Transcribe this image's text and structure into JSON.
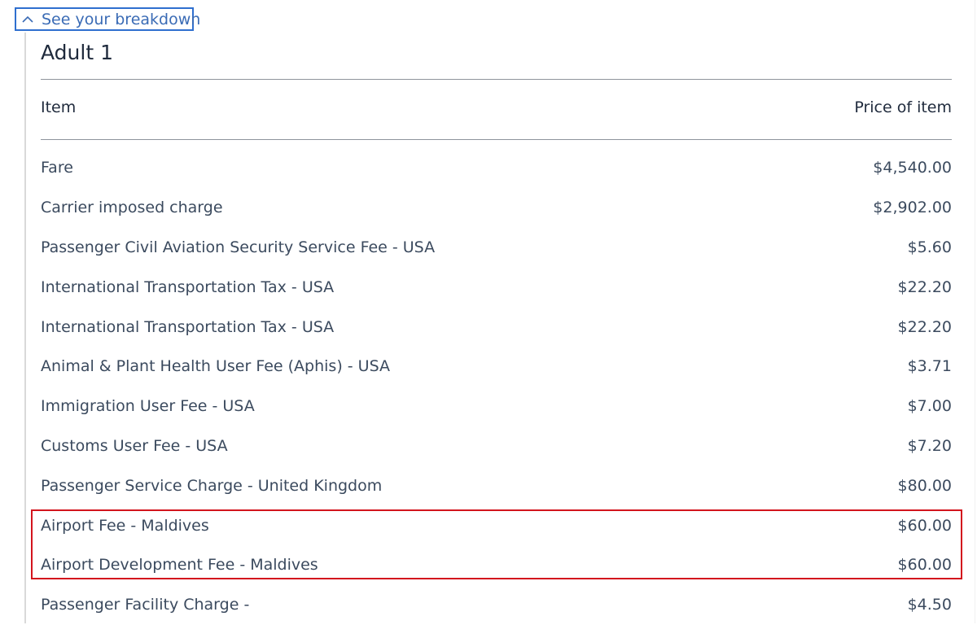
{
  "breakdown_toggle": {
    "label": "See your breakdown",
    "icon": "chevron-up-icon",
    "expanded": true,
    "border_color": "#2f6fcf"
  },
  "passenger": {
    "title": "Adult 1"
  },
  "table": {
    "headers": {
      "item": "Item",
      "price": "Price of item"
    },
    "rows": [
      {
        "label": "Fare",
        "price": "$4,540.00"
      },
      {
        "label": "Carrier imposed charge",
        "price": "$2,902.00"
      },
      {
        "label": "Passenger Civil Aviation Security Service Fee - USA",
        "price": "$5.60"
      },
      {
        "label": "International Transportation Tax - USA",
        "price": "$22.20"
      },
      {
        "label": "International Transportation Tax - USA",
        "price": "$22.20"
      },
      {
        "label": "Animal & Plant Health User Fee (Aphis) - USA",
        "price": "$3.71"
      },
      {
        "label": "Immigration User Fee - USA",
        "price": "$7.00"
      },
      {
        "label": "Customs User Fee - USA",
        "price": "$7.20"
      },
      {
        "label": "Passenger Service Charge - United Kingdom",
        "price": "$80.00"
      },
      {
        "label": "Airport Fee - Maldives",
        "price": "$60.00"
      },
      {
        "label": "Airport Development Fee - Maldives",
        "price": "$60.00"
      },
      {
        "label": "Passenger Facility Charge -",
        "price": "$4.50"
      }
    ]
  },
  "annotation": {
    "highlighted_rows": [
      "Airport Fee - Maldives",
      "Airport Development Fee - Maldives"
    ],
    "color": "#d3141d"
  }
}
